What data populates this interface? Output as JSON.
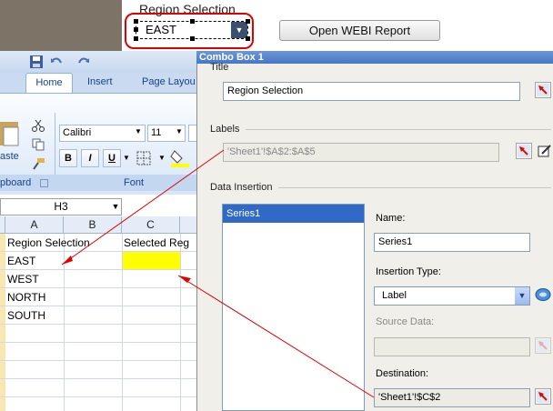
{
  "dashboard": {
    "combo_title": "Region Selection",
    "combo_value": "EAST",
    "webi_button": "Open WEBI Report"
  },
  "excel": {
    "tabs": [
      "Home",
      "Insert",
      "Page Layou"
    ],
    "font_name": "Calibri",
    "font_size": "11",
    "clipboard_group": "pboard",
    "font_group": "Font",
    "paste_label": "aste",
    "bold": "B",
    "italic": "I",
    "underline": "U",
    "name_box": "H3",
    "columns": [
      "A",
      "B",
      "C"
    ],
    "cells": {
      "a1": "Region Selection",
      "c1": "Selected Reg",
      "a2": "EAST",
      "a3": "WEST",
      "a4": "NORTH",
      "a5": "SOUTH"
    },
    "highlight_color": "#ffff00"
  },
  "panel": {
    "header": "Combo Box 1",
    "title_section": "Title",
    "title_value": "Region Selection",
    "labels_section": "Labels",
    "labels_value": "'Sheet1'!$A$2:$A$5",
    "data_insertion_section": "Data Insertion",
    "series_item": "Series1",
    "name_label": "Name:",
    "name_value": "Series1",
    "insertion_type_label": "Insertion Type:",
    "insertion_type_value": "Label",
    "source_data_label": "Source Data:",
    "destination_label": "Destination:",
    "destination_value": "'Sheet1'!$C$2"
  },
  "colors": {
    "accent": "#e00000",
    "header": "#4677c6",
    "selection": "#3169c6"
  }
}
